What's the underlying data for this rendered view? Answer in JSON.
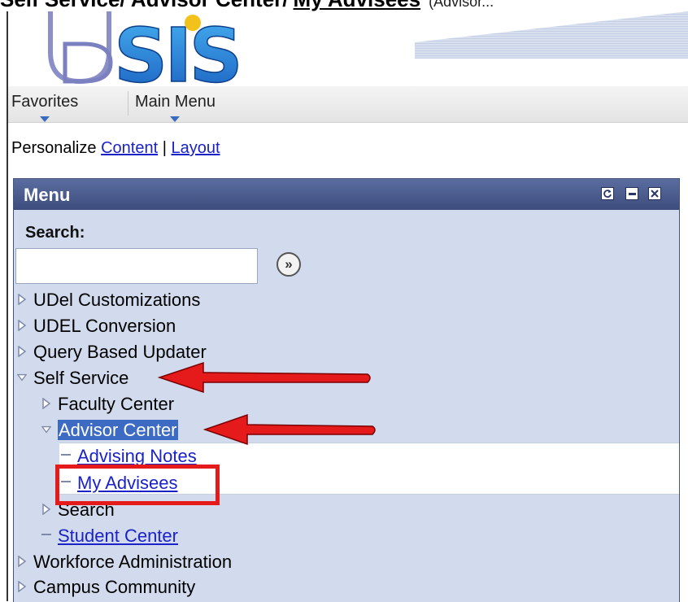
{
  "caption": {
    "text": "Self Service/ Advisor Center/",
    "link": "My Advisees",
    "note": "(Advisor..."
  },
  "logo": {
    "text": "USIS"
  },
  "navbar": {
    "favorites": "Favorites",
    "main_menu": "Main Menu"
  },
  "personalize": {
    "label": "Personalize",
    "content": "Content",
    "separator": "|",
    "layout": "Layout"
  },
  "portlet": {
    "title": "Menu",
    "search_label": "Search:",
    "search_value": "",
    "go_symbol": "»"
  },
  "tree": [
    {
      "label": "UDel Customizations",
      "state": "collapsed"
    },
    {
      "label": "UDEL Conversion",
      "state": "collapsed"
    },
    {
      "label": "Query Based Updater",
      "state": "collapsed"
    },
    {
      "label": "Self Service",
      "state": "expanded"
    },
    {
      "label": "Faculty Center",
      "state": "collapsed"
    },
    {
      "label": "Advisor Center",
      "state": "expanded-selected"
    },
    {
      "label": "Advising Notes",
      "state": "link"
    },
    {
      "label": "My Advisees",
      "state": "link"
    },
    {
      "label": "Search",
      "state": "collapsed"
    },
    {
      "label": "Student Center",
      "state": "link"
    },
    {
      "label": "Workforce Administration",
      "state": "collapsed"
    },
    {
      "label": "Campus Community",
      "state": "collapsed"
    }
  ],
  "colors": {
    "link": "#1a22c8",
    "highlight": "#3d6bc4",
    "annotation_red": "#e51a1a",
    "portlet_header": "#45557a",
    "portlet_body": "#d2dbed"
  }
}
